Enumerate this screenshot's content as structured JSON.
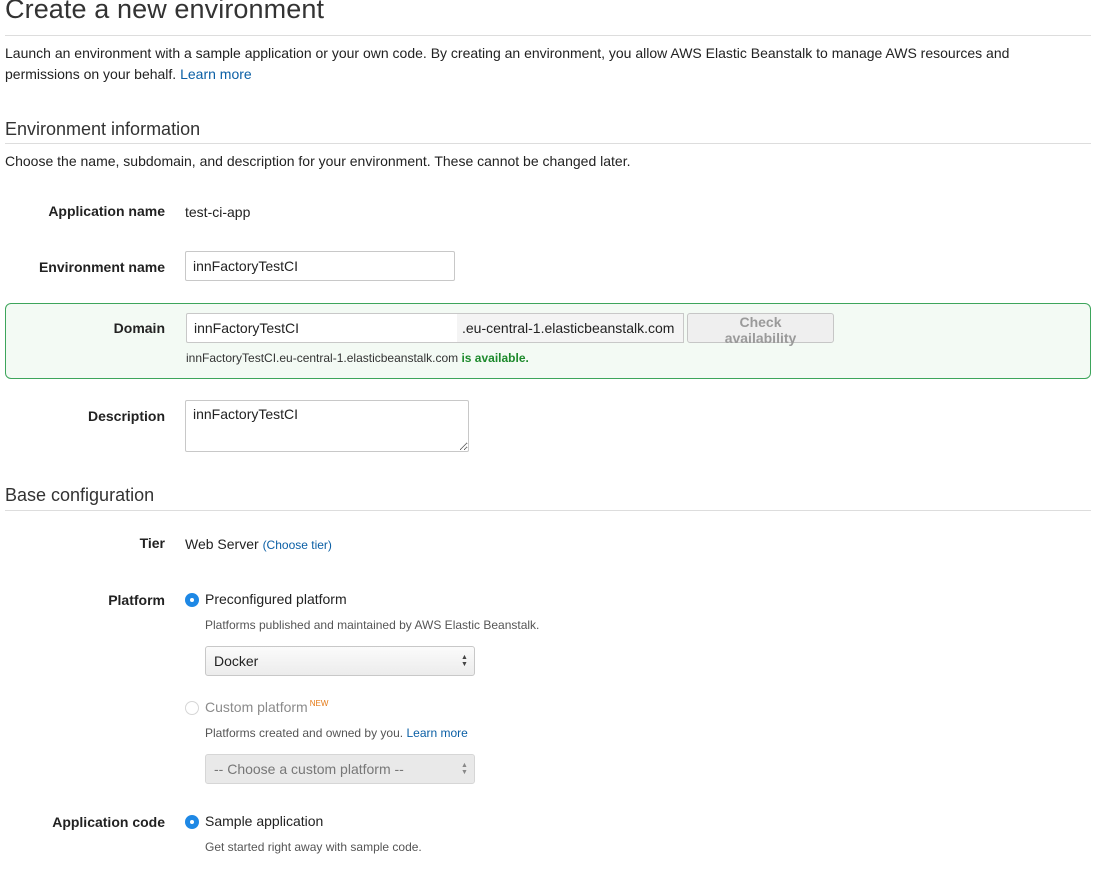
{
  "page": {
    "title": "Create a new environment",
    "intro_text": "Launch an environment with a sample application or your own code. By creating an environment, you allow AWS Elastic Beanstalk to manage AWS resources and permissions on your behalf.",
    "learn_more": "Learn more"
  },
  "env_info": {
    "title": "Environment information",
    "description": "Choose the name, subdomain, and description for your environment. These cannot be changed later.",
    "application_name_label": "Application name",
    "application_name_value": "test-ci-app",
    "environment_name_label": "Environment name",
    "environment_name_value": "innFactoryTestCI",
    "domain_label": "Domain",
    "domain_value": "innFactoryTestCI",
    "domain_suffix": ".eu-central-1.elasticbeanstalk.com",
    "check_button": "Check availability",
    "availability_domain": "innFactoryTestCI.eu-central-1.elasticbeanstalk.com",
    "availability_status": "is available.",
    "description_label": "Description",
    "description_value": "innFactoryTestCI",
    "colors": {
      "success_border": "#3da55b",
      "success_text": "#1d8a2c",
      "link": "#0b5fa5"
    }
  },
  "base_config": {
    "title": "Base configuration",
    "tier_label": "Tier",
    "tier_value": "Web Server",
    "tier_link": "(Choose tier)",
    "platform_label": "Platform",
    "preconfigured_label": "Preconfigured platform",
    "preconfigured_help": "Platforms published and maintained by AWS Elastic Beanstalk.",
    "preconfigured_selected": "Docker",
    "custom_label": "Custom platform",
    "custom_badge": "NEW",
    "custom_help": "Platforms created and owned by you.",
    "custom_learn_more": "Learn more",
    "custom_select": "-- Choose a custom platform --",
    "app_code_label": "Application code",
    "sample_label": "Sample application",
    "sample_help": "Get started right away with sample code.",
    "radio_color": "#1e88e5"
  },
  "icons": {
    "select_arrows": "updown-arrows-icon",
    "radio_selected": "radio-selected-icon",
    "radio_unselected": "radio-unselected-icon"
  }
}
